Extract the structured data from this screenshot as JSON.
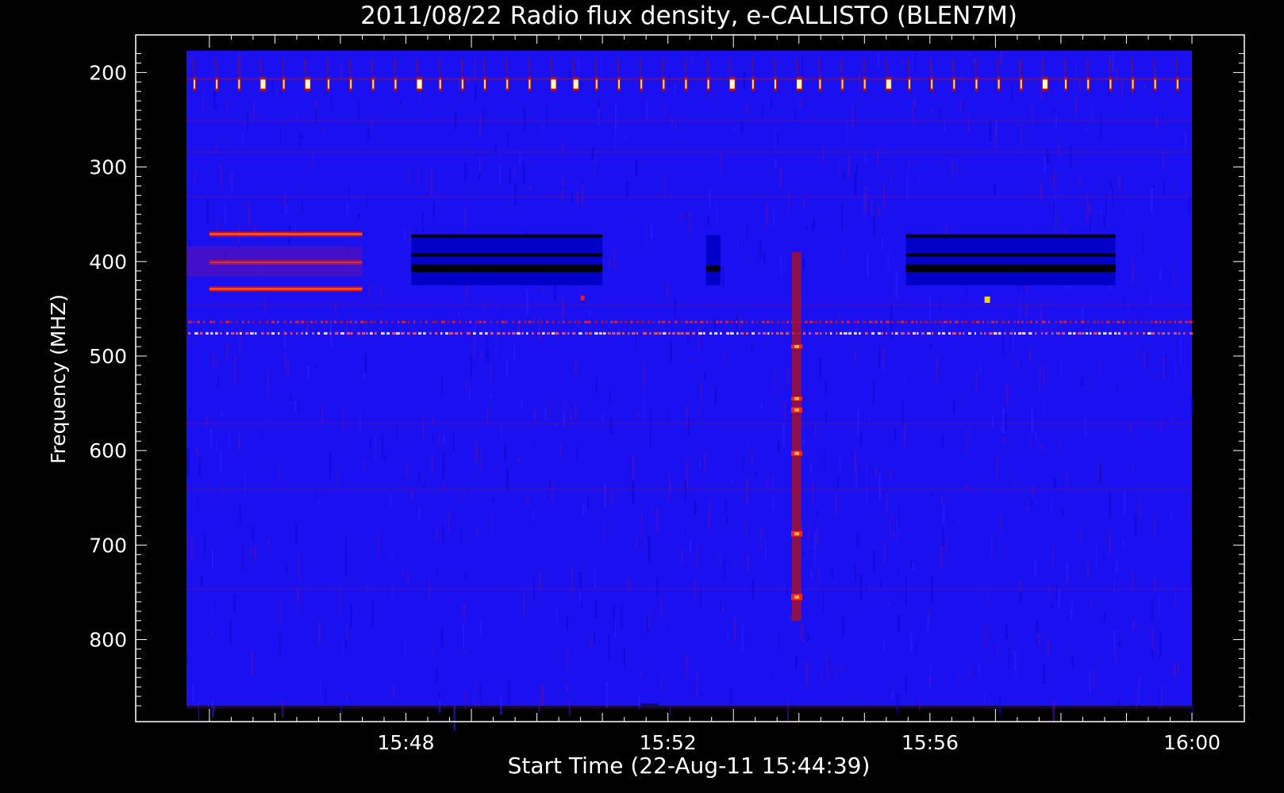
{
  "chart_data": {
    "type": "heatmap",
    "title": "2011/08/22  Radio flux density, e-CALLISTO (BLEN7M)",
    "xlabel": "Start Time (22-Aug-11 15:44:39)",
    "ylabel": "Frequency (MHZ)",
    "x_range_minutes": [
      "15:44:39",
      "16:00:00"
    ],
    "y_range_mhz": [
      177,
      870
    ],
    "y_inverted": true,
    "x_ticks": [
      {
        "label": "15:48",
        "minute": "15:48"
      },
      {
        "label": "15:52",
        "minute": "15:52"
      },
      {
        "label": "15:56",
        "minute": "15:56"
      },
      {
        "label": "16:00",
        "minute": "16:00"
      }
    ],
    "y_ticks": [
      200,
      300,
      400,
      500,
      600,
      700,
      800
    ],
    "colormap": [
      "#000000",
      "#0000ff",
      "#7f0080",
      "#ff0000",
      "#ffff00",
      "#ffffff"
    ],
    "background_color": "#1a10f0",
    "features": {
      "periodic_spikes_mhz": 212,
      "rfi_lines_mhz": [
        464,
        476
      ],
      "early_red_bands": {
        "start": "15:45:00",
        "end": "15:47:20",
        "freqs_mhz": [
          371,
          401,
          429
        ]
      },
      "dark_block_bands": [
        {
          "start": "15:48:05",
          "end": "15:51:00",
          "freqs_mhz": [
            373,
            393,
            407
          ]
        },
        {
          "start": "15:55:38",
          "end": "15:58:50",
          "freqs_mhz": [
            373,
            393,
            407
          ]
        }
      ],
      "burst": {
        "time": "15:53:58",
        "freq_range_mhz": [
          390,
          780
        ]
      }
    }
  }
}
